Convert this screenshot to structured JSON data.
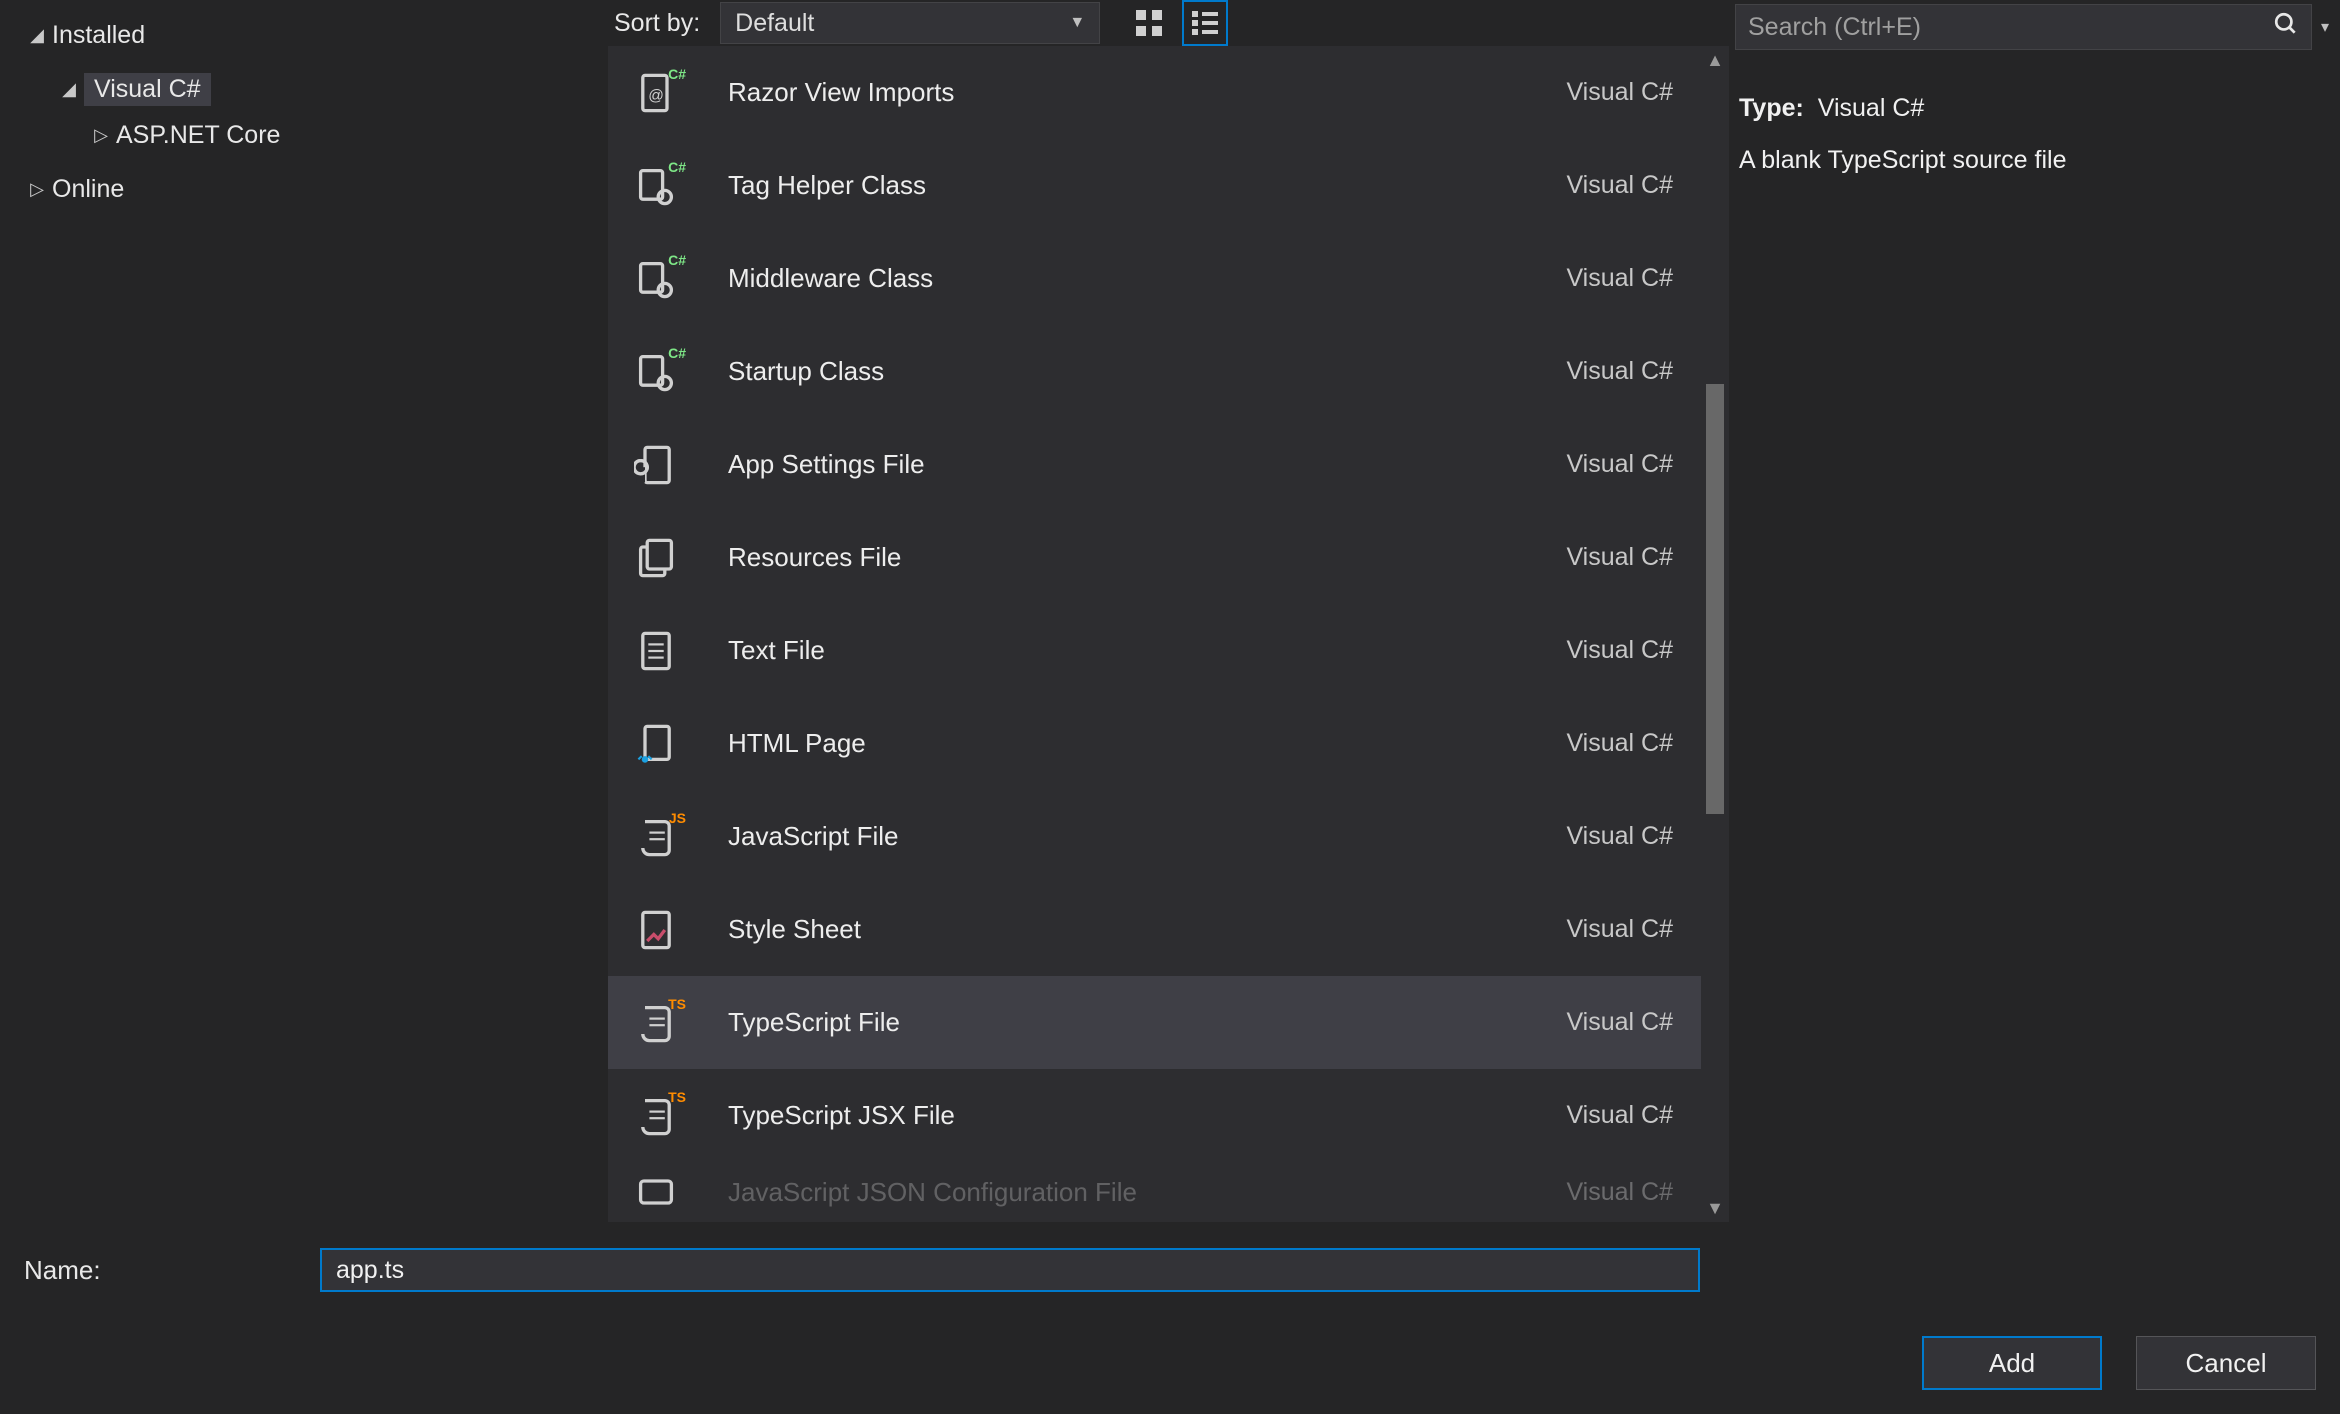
{
  "tree": {
    "installed": "Installed",
    "visual_csharp": "Visual C#",
    "aspnet_core": "ASP.NET Core",
    "online": "Online"
  },
  "sort": {
    "label": "Sort by:",
    "value": "Default"
  },
  "search": {
    "placeholder": "Search (Ctrl+E)"
  },
  "templates": {
    "lang": "Visual C#",
    "items": [
      {
        "name": "Razor View Imports",
        "icon": "cs-file",
        "badge": "C#"
      },
      {
        "name": "Tag Helper Class",
        "icon": "cs-class",
        "badge": "C#"
      },
      {
        "name": "Middleware Class",
        "icon": "cs-class",
        "badge": "C#"
      },
      {
        "name": "Startup Class",
        "icon": "cs-class",
        "badge": "C#"
      },
      {
        "name": "App Settings File",
        "icon": "settings",
        "badge": ""
      },
      {
        "name": "Resources File",
        "icon": "resources",
        "badge": ""
      },
      {
        "name": "Text File",
        "icon": "text",
        "badge": ""
      },
      {
        "name": "HTML Page",
        "icon": "html",
        "badge": ""
      },
      {
        "name": "JavaScript File",
        "icon": "script",
        "badge": "JS"
      },
      {
        "name": "Style Sheet",
        "icon": "style",
        "badge": ""
      },
      {
        "name": "TypeScript File",
        "icon": "script",
        "badge": "TS",
        "selected": true
      },
      {
        "name": "TypeScript JSX File",
        "icon": "script",
        "badge": "TS"
      }
    ],
    "partial": "JavaScript JSON Configuration File"
  },
  "info": {
    "type_label": "Type:",
    "type_value": "Visual C#",
    "description": "A blank TypeScript source file"
  },
  "footer": {
    "name_label": "Name:",
    "name_value": "app.ts",
    "add": "Add",
    "cancel": "Cancel"
  }
}
